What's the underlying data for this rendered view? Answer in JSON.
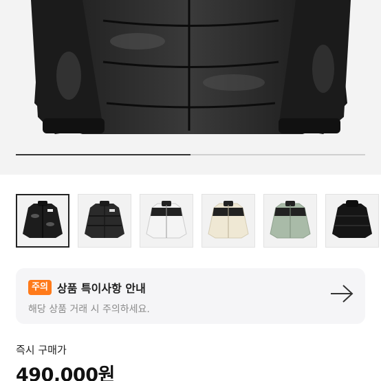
{
  "gallery": {
    "current_slide": 1,
    "slide_count": 2,
    "progress_fraction": 0.5,
    "thumbnails": [
      {
        "name": "thumb-black-glossy-front",
        "color": "black-glossy"
      },
      {
        "name": "thumb-black-matte",
        "color": "black-matte"
      },
      {
        "name": "thumb-white-black",
        "color": "white"
      },
      {
        "name": "thumb-cream-black",
        "color": "cream"
      },
      {
        "name": "thumb-sage-black",
        "color": "sage"
      },
      {
        "name": "thumb-black-back",
        "color": "black"
      }
    ],
    "selected_index": 0
  },
  "notice": {
    "badge": "주의",
    "title": "상품 특이사항 안내",
    "subtitle": "해당 상품 거래 시 주의하세요.",
    "icon": "arrow-right-icon",
    "badge_color": "#ff7a1a"
  },
  "purchase": {
    "label": "즉시 구매가",
    "price": "490,000원"
  }
}
